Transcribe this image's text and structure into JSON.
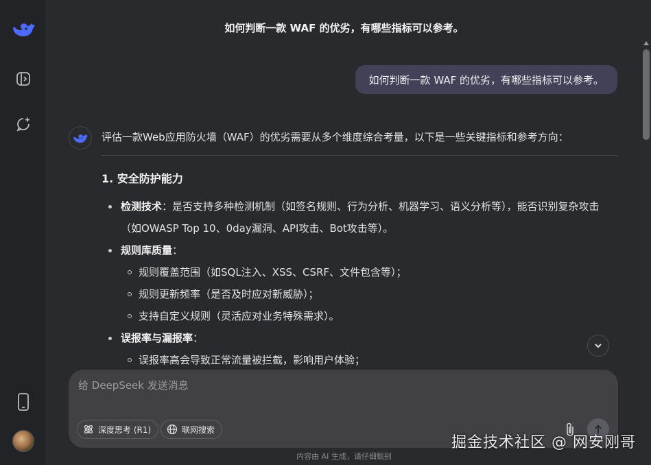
{
  "sidebar": {
    "logo_icon": "deepseek-whale-icon",
    "toggle_icon": "sidebar-toggle-icon",
    "new_chat_icon": "new-chat-icon",
    "phone_icon": "mobile-app-icon",
    "avatar_icon": "user-avatar"
  },
  "chat": {
    "title": "如何判断一款 WAF 的优劣，有哪些指标可以参考。",
    "user_message": "如何判断一款 WAF 的优劣，有哪些指标可以参考。",
    "ai": {
      "intro": "评估一款Web应用防火墙（WAF）的优劣需要从多个维度综合考量，以下是一些关键指标和参考方向：",
      "section_title": "1. 安全防护能力",
      "items": [
        {
          "label": "检测技术",
          "text": "：是否支持多种检测机制（如签名规则、行为分析、机器学习、语义分析等），能否识别复杂攻击（如OWASP Top 10、0day漏洞、API攻击、Bot攻击等）。"
        },
        {
          "label": "规则库质量",
          "text": "："
        },
        {
          "label": "误报率与漏报率",
          "text": "："
        }
      ],
      "rule_subitems": [
        "规则覆盖范围（如SQL注入、XSS、CSRF、文件包含等）；",
        "规则更新频率（是否及时应对新威胁）；",
        "支持自定义规则（灵活应对业务特殊需求）。"
      ],
      "fp_subitems": [
        "误报率高会导致正常流量被拦截，影响用户体验；"
      ]
    }
  },
  "composer": {
    "placeholder": "给 DeepSeek 发送消息",
    "deep_think_label": "深度思考 (R1)",
    "web_search_label": "联网搜索"
  },
  "footer": {
    "disclaimer": "内容由 AI 生成，请仔细甄别",
    "watermark": "掘金技术社区 @ 网安刚哥"
  },
  "colors": {
    "background": "#292a2d",
    "sidebar": "#212327",
    "user_bubble": "#414158",
    "composer": "#404045",
    "accent": "#4d6bfe"
  }
}
